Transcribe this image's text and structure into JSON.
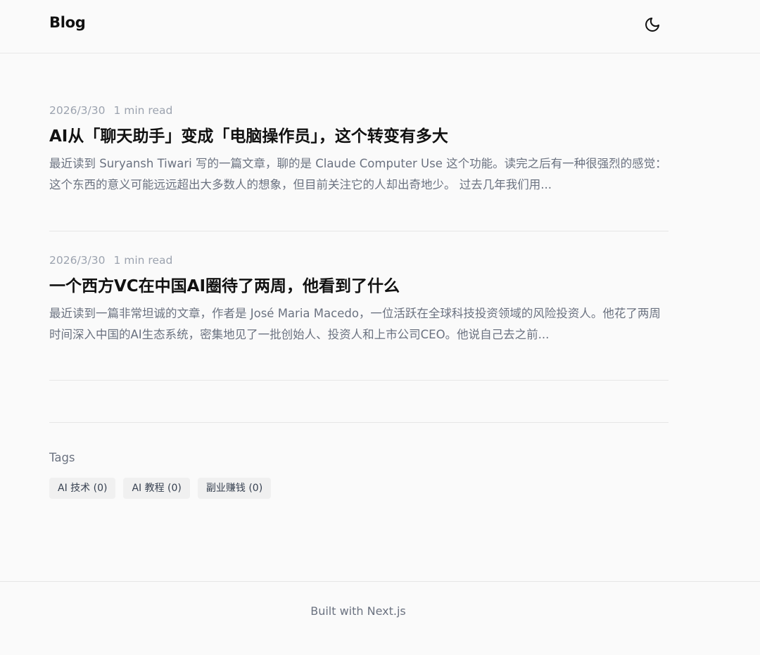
{
  "header": {
    "logo": "Blog",
    "theme_toggle_icon": "moon-icon"
  },
  "posts": [
    {
      "date": "2026/3/30",
      "read_time": "1 min read",
      "title": "AI从「聊天助手」变成「电脑操作员」，这个转变有多大",
      "excerpt": "最近读到 Suryansh Tiwari 写的一篇文章，聊的是 Claude Computer Use 这个功能。读完之后有一种很强烈的感觉：这个东西的意义可能远远超出大多数人的想象，但目前关注它的人却出奇地少。 过去几年我们用..."
    },
    {
      "date": "2026/3/30",
      "read_time": "1 min read",
      "title": "一个西方VC在中国AI圈待了两周，他看到了什么",
      "excerpt": "最近读到一篇非常坦诚的文章，作者是 José Maria Macedo，一位活跃在全球科技投资领域的风险投资人。他花了两周时间深入中国的AI生态系统，密集地见了一批创始人、投资人和上市公司CEO。他说自己去之前..."
    }
  ],
  "tags": {
    "heading": "Tags",
    "items": [
      {
        "label": "AI 技术 (0)"
      },
      {
        "label": "AI 教程 (0)"
      },
      {
        "label": "副业赚钱 (0)"
      }
    ]
  },
  "footer": {
    "text": "Built with Next.js"
  },
  "colors": {
    "background": "#fafafa",
    "text": "#111111",
    "muted": "#6b7280",
    "meta": "#9ca3af",
    "border": "#e6e6e6",
    "tag_bg": "#f0f0f0"
  }
}
